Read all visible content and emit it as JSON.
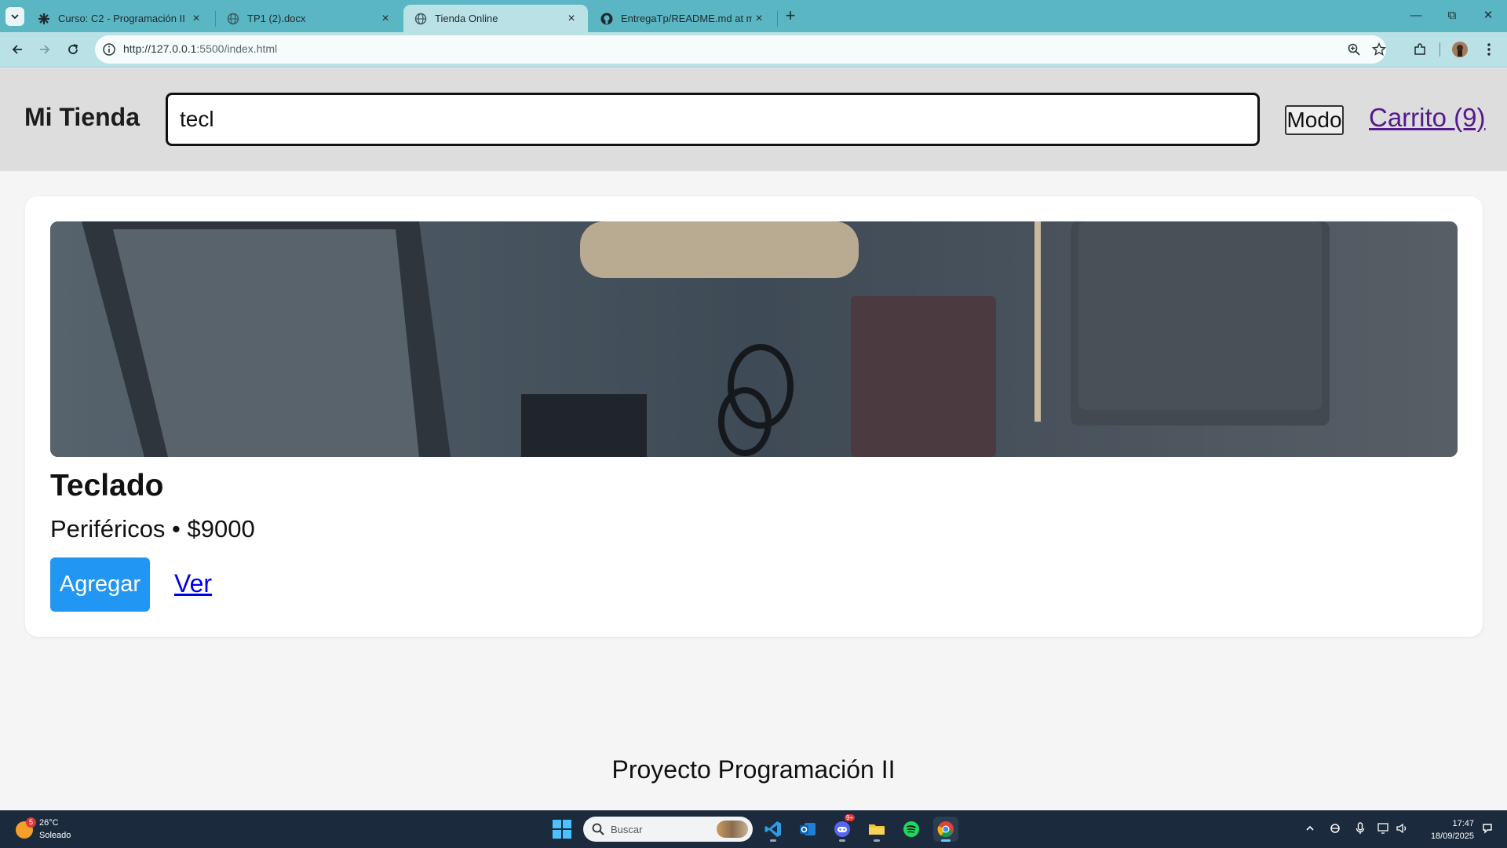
{
  "browser": {
    "tabs": [
      {
        "title": "Curso: C2 - Programación II",
        "icon": "moodle-icon",
        "active": false
      },
      {
        "title": "TP1 (2).docx",
        "icon": "globe-icon",
        "active": false
      },
      {
        "title": "Tienda Online",
        "icon": "globe-icon",
        "active": true
      },
      {
        "title": "EntregaTp/README.md at main",
        "icon": "github-icon",
        "active": false
      }
    ],
    "url_host": "http://127.0.0.1",
    "url_path": ":5500/index.html"
  },
  "page": {
    "brand": "Mi Tienda",
    "search_value": "tecl",
    "mode_label": "Modo",
    "cart_label": "Carrito (9)",
    "product": {
      "name": "Teclado",
      "meta": "Periféricos • $9000",
      "add_label": "Agregar",
      "view_label": "Ver"
    },
    "footer": "Proyecto Programación II"
  },
  "taskbar": {
    "weather_badge": "5",
    "temperature": "26°C",
    "condition": "Soleado",
    "search_label": "Buscar",
    "discord_badge": "9+",
    "time": "17:47",
    "date": "18/09/2025"
  },
  "colors": {
    "tabstrip": "#5bb6c4",
    "toolbar": "#b9e1e6",
    "header": "#dddddd",
    "add_button": "#2196f3",
    "taskbar": "#1b2a3c"
  }
}
